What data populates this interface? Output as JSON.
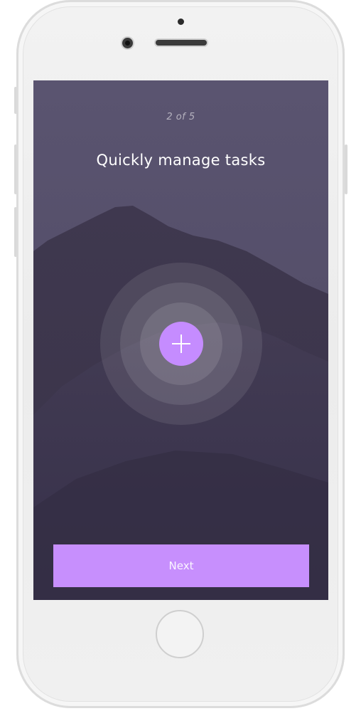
{
  "onboarding": {
    "step_indicator": "2 of 5",
    "title": "Quickly manage tasks",
    "add_icon": "plus-icon",
    "next_label": "Next"
  },
  "colors": {
    "accent": "#c58cff",
    "overlay": "#4b4560",
    "button": "#c78ffd"
  }
}
